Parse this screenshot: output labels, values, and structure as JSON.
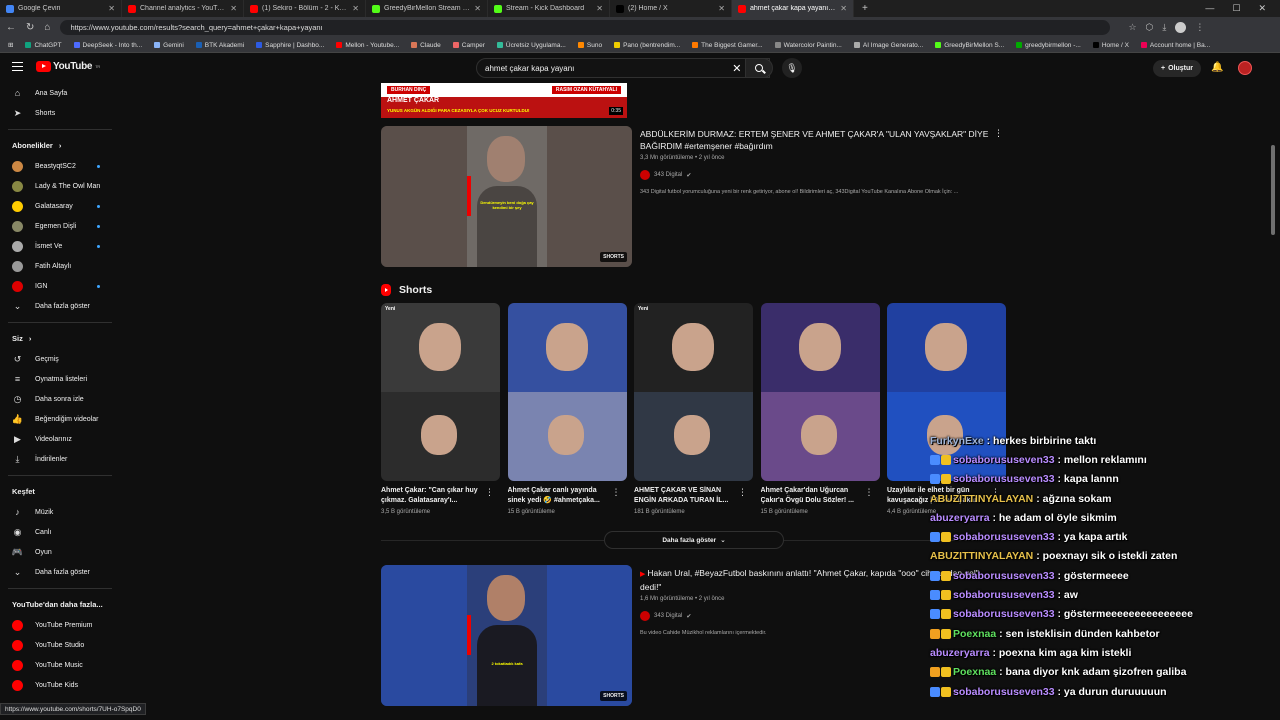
{
  "browser": {
    "tabs": [
      {
        "title": "Google Çeviri",
        "color": "#4285f4"
      },
      {
        "title": "Channel analytics - YouTube Studio",
        "color": "#ff0000"
      },
      {
        "title": "(1) Sekiro - Bölüm - 2 - Kolay Boss",
        "color": "#ff0000"
      },
      {
        "title": "GreedyBirMellon Stream - Watch Li",
        "color": "#53fc18"
      },
      {
        "title": "Stream - Kick Dashboard",
        "color": "#53fc18"
      },
      {
        "title": "(2) Home / X",
        "color": "#000000"
      },
      {
        "title": "ahmet çakar kapa yayanı - YouTube",
        "color": "#ff0000",
        "active": true
      }
    ],
    "url": "https://www.youtube.com/results?search_query=ahmet+çakar+kapa+yayanı",
    "bookmarks": [
      "ChatGPT",
      "DeepSeek - Into th...",
      "Gemini",
      "BTK Akademi",
      "Sapphire | Dashbo...",
      "Mellon - Youtube...",
      "Claude",
      "Camper",
      "Ücretsiz Uygulama...",
      "Suno",
      "Pano (bentrendim...",
      "The Biggest Gamer...",
      "Watercolor Paintin...",
      "AI Image Generato...",
      "GreedyBirMellon S...",
      "greedybirmellon -...",
      "Home / X",
      "Account home | Ba..."
    ],
    "status_url": "https://www.youtube.com/shorts/7UH-o7SpqD0"
  },
  "header": {
    "logo": "YouTube",
    "logo_sup": "TR",
    "search_query": "ahmet çakar kapa yayanı",
    "create_label": "Oluştur"
  },
  "sidebar": {
    "top": [
      {
        "label": "Ana Sayfa",
        "icon": "home-icon",
        "glyph": "⌂"
      },
      {
        "label": "Shorts",
        "icon": "shorts-icon",
        "glyph": "➤"
      }
    ],
    "subs_title": "Abonelikler",
    "subs": [
      {
        "label": "BeastyqtSC2",
        "color": "#c84",
        "dot": true
      },
      {
        "label": "Lady & The Owl Man",
        "color": "#884",
        "dot": false
      },
      {
        "label": "Galatasaray",
        "color": "#fc0",
        "dot": true
      },
      {
        "label": "Egemen Dişli",
        "color": "#886",
        "dot": true
      },
      {
        "label": "İsmet Ve",
        "color": "#aaa",
        "dot": true
      },
      {
        "label": "Fatih Altaylı",
        "color": "#999",
        "dot": false
      },
      {
        "label": "IGN",
        "color": "#d00",
        "dot": true
      }
    ],
    "subs_more": "Daha fazla göster",
    "you_title": "Siz",
    "you": [
      {
        "label": "Geçmiş",
        "glyph": "↺"
      },
      {
        "label": "Oynatma listeleri",
        "glyph": "≡"
      },
      {
        "label": "Daha sonra izle",
        "glyph": "◷"
      },
      {
        "label": "Beğendiğim videolar",
        "glyph": "👍"
      },
      {
        "label": "Videolarınız",
        "glyph": "▶"
      },
      {
        "label": "İndirilenler",
        "glyph": "⤓"
      }
    ],
    "explore_title": "Keşfet",
    "explore": [
      {
        "label": "Müzik",
        "glyph": "♪"
      },
      {
        "label": "Canlı",
        "glyph": "◉"
      },
      {
        "label": "Oyun",
        "glyph": "🎮"
      },
      {
        "label": "Daha fazla göster",
        "glyph": "⌄"
      }
    ],
    "more_title": "YouTube'dan daha fazla...",
    "more": [
      "YouTube Premium",
      "YouTube Studio",
      "YouTube Music",
      "YouTube Kids"
    ]
  },
  "results": {
    "top_thumb": {
      "strip_left": "BURHAN DINÇ",
      "strip_right": "RASIM OZAN KÜTAHYALI",
      "title": "AHMET ÇAKAR",
      "subtitle": "YUNUS AKGÜN ALDIĞI PARA CEZASIYLA ÇOK UCUZ KURTULDU!",
      "duration": "0:35"
    },
    "video1": {
      "title": "ABDÜLKERİM DURMAZ: ERTEM ŞENER VE AHMET ÇAKAR'A \"ULAN YAVŞAKLAR\" DİYE BAĞIRDIM #ertemşener #bağırdım",
      "meta": "3,3 Mn görüntüleme • 2 yıl önce",
      "channel": "343 Digital",
      "desc": "343 Digital futbol yorumculuğuna yeni bir renk getiriyor, abone ol! Bildirimleri aç, 343Digital YouTube Kanalına Abone Olmak İçin: ...",
      "badge": "SHORTS",
      "caption": "Dendürmeyin beni doğa çay kendimi bir şey"
    },
    "shelf_title": "Shorts",
    "shorts": [
      {
        "title": "Ahmet Çakar: \"Can çıkar huy çıkmaz. Galatasaray'ı...",
        "views": "3,5 B görüntüleme",
        "yeni": "Yeni",
        "top": "#3a3a3a",
        "bottom": "#2c2c2c"
      },
      {
        "title": "Ahmet Çakar canlı yayında sinek yedi 🤣 #ahmetçaka...",
        "views": "15 B görüntüleme",
        "yeni": "",
        "top": "#3550a0",
        "bottom": "#7a84b0"
      },
      {
        "title": "AHMET ÇAKAR VE SİNAN ENGİN ARKADA TURAN İL...",
        "views": "181 B görüntüleme",
        "yeni": "Yeni",
        "top": "#222",
        "bottom": "#303845"
      },
      {
        "title": "Ahmet Çakar'dan Uğurcan Çakır'a Övgü Dolu Sözler! ...",
        "views": "15 B görüntüleme",
        "yeni": "",
        "top": "#3a2d6a",
        "bottom": "#6a4a8a"
      },
      {
        "title": "Uzaylılar ile elhet bir gün kavuşacağız | Ahmet Çakar",
        "views": "4,4 B görüntüleme",
        "yeni": "",
        "top": "#2040a0",
        "bottom": "#2050c0"
      }
    ],
    "more_label": "Daha fazla göster",
    "video2": {
      "title": "Hakan Ural, #BeyazFutbol baskınını anlattı! \"Ahmet Çakar, kapıda \"ooo\" cihyamdan gel\" dedi!\"",
      "meta": "1,6 Mn görüntüleme • 2 yıl önce",
      "channel": "343 Digital",
      "desc": "Bu video Cahide Müzikhol reklamlarını içermektedir.",
      "badge": "SHORTS",
      "caption": "2 tokatladık kafa"
    }
  },
  "chat": [
    {
      "user": "FurkynExe",
      "color": "#9fb4d8",
      "msg": "herkes birbirine taktı",
      "badges": []
    },
    {
      "user": "sobaborususeven33",
      "color": "#b98cff",
      "msg": "mellon reklamını",
      "badges": [
        "#4a8cff",
        "#f0c020"
      ]
    },
    {
      "user": "sobaborususeven33",
      "color": "#b98cff",
      "msg": "kapa lannn",
      "badges": [
        "#4a8cff",
        "#f0c020"
      ]
    },
    {
      "user": "ABUZITTINYALAYAN",
      "color": "#e6c04a",
      "msg": "ağzına sokam",
      "badges": []
    },
    {
      "user": "abuzeryarra",
      "color": "#b98cff",
      "msg": "he adam ol öyle sikmim",
      "badges": []
    },
    {
      "user": "sobaborususeven33",
      "color": "#b98cff",
      "msg": "ya kapa artık",
      "badges": [
        "#4a8cff",
        "#f0c020"
      ]
    },
    {
      "user": "ABUZITTINYALAYAN",
      "color": "#e6c04a",
      "msg": "poexnayı sik o istekli zaten",
      "badges": []
    },
    {
      "user": "sobaborususeven33",
      "color": "#b98cff",
      "msg": "göstermeeee",
      "badges": [
        "#4a8cff",
        "#f0c020"
      ]
    },
    {
      "user": "sobaborususeven33",
      "color": "#b98cff",
      "msg": "aw",
      "badges": [
        "#4a8cff",
        "#f0c020"
      ]
    },
    {
      "user": "sobaborususeven33",
      "color": "#b98cff",
      "msg": "göstermeeeeeeeeeeeeeee",
      "badges": [
        "#4a8cff",
        "#f0c020"
      ]
    },
    {
      "user": "Poexnaa",
      "color": "#5fe05f",
      "msg": "sen isteklisin dünden kahbetor",
      "badges": [
        "#f0a020",
        "#f0c020"
      ]
    },
    {
      "user": "abuzeryarra",
      "color": "#b98cff",
      "msg": "poexna kim aga kim istekli",
      "badges": []
    },
    {
      "user": "Poexnaa",
      "color": "#5fe05f",
      "msg": "bana diyor knk adam şizofren galiba",
      "badges": [
        "#f0a020",
        "#f0c020"
      ]
    },
    {
      "user": "sobaborususeven33",
      "color": "#b98cff",
      "msg": "ya durun duruuuuun",
      "badges": [
        "#4a8cff",
        "#f0c020"
      ]
    }
  ]
}
